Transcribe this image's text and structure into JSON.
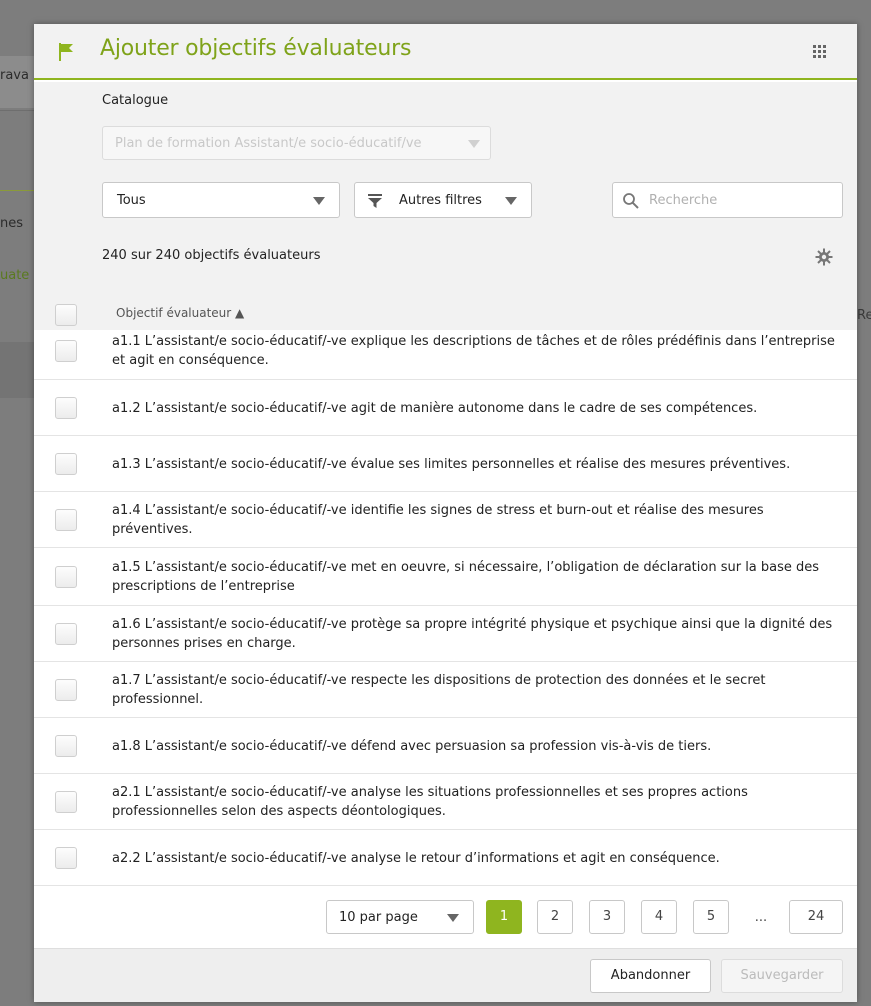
{
  "background": {
    "fragments": [
      "rava",
      "nes",
      "uate"
    ],
    "fragment_right": "Re"
  },
  "modal": {
    "title": "Ajouter objectifs évaluateurs",
    "catalogue_label": "Catalogue",
    "catalogue_value": "Plan de formation Assistant/e socio-éducatif/ve",
    "filter_select": "Tous",
    "more_filters_label": "Autres filtres",
    "search_placeholder": "Recherche",
    "count_text": "240 sur 240 objectifs évaluateurs",
    "column_header": "Objectif évaluateur ▲",
    "rows": [
      "a1.1 L’assistant/e socio-éducatif/-ve explique les descriptions de tâches et de rôles prédéfinis dans l’entreprise et agit en conséquence.",
      "a1.2 L’assistant/e socio-éducatif/-ve agit de manière autonome dans le cadre de ses compétences.",
      "a1.3 L’assistant/e socio-éducatif/-ve évalue ses limites personnelles et réalise des mesures préventives.",
      "a1.4 L’assistant/e socio-éducatif/-ve identifie les signes de stress et burn-out et réalise des mesures préventives.",
      "a1.5 L’assistant/e socio-éducatif/-ve met en oeuvre, si nécessaire, l’obligation de déclaration sur la base des prescriptions de l’entreprise",
      "a1.6 L’assistant/e socio-éducatif/-ve protège sa propre intégrité physique et psychique ainsi que la dignité des personnes prises en charge.",
      "a1.7 L’assistant/e socio-éducatif/-ve respecte les dispositions de protection des données et le secret professionnel.",
      "a1.8 L’assistant/e socio-éducatif/-ve défend avec persuasion sa profession vis-à-vis de tiers.",
      "a2.1 L’assistant/e socio-éducatif/-ve analyse les situations professionnelles et ses propres actions professionnelles selon des aspects déontologiques.",
      "a2.2 L’assistant/e socio-éducatif/-ve analyse le retour d’informations et agit en conséquence."
    ],
    "pagination": {
      "per_page": "10 par page",
      "pages": [
        "1",
        "2",
        "3",
        "4",
        "5"
      ],
      "ellipsis": "...",
      "last_page": "24",
      "current_page": "1"
    },
    "buttons": {
      "cancel": "Abandonner",
      "save": "Sauvegarder"
    },
    "colors": {
      "accent": "#8fb51f",
      "title": "#7fa31a"
    }
  }
}
